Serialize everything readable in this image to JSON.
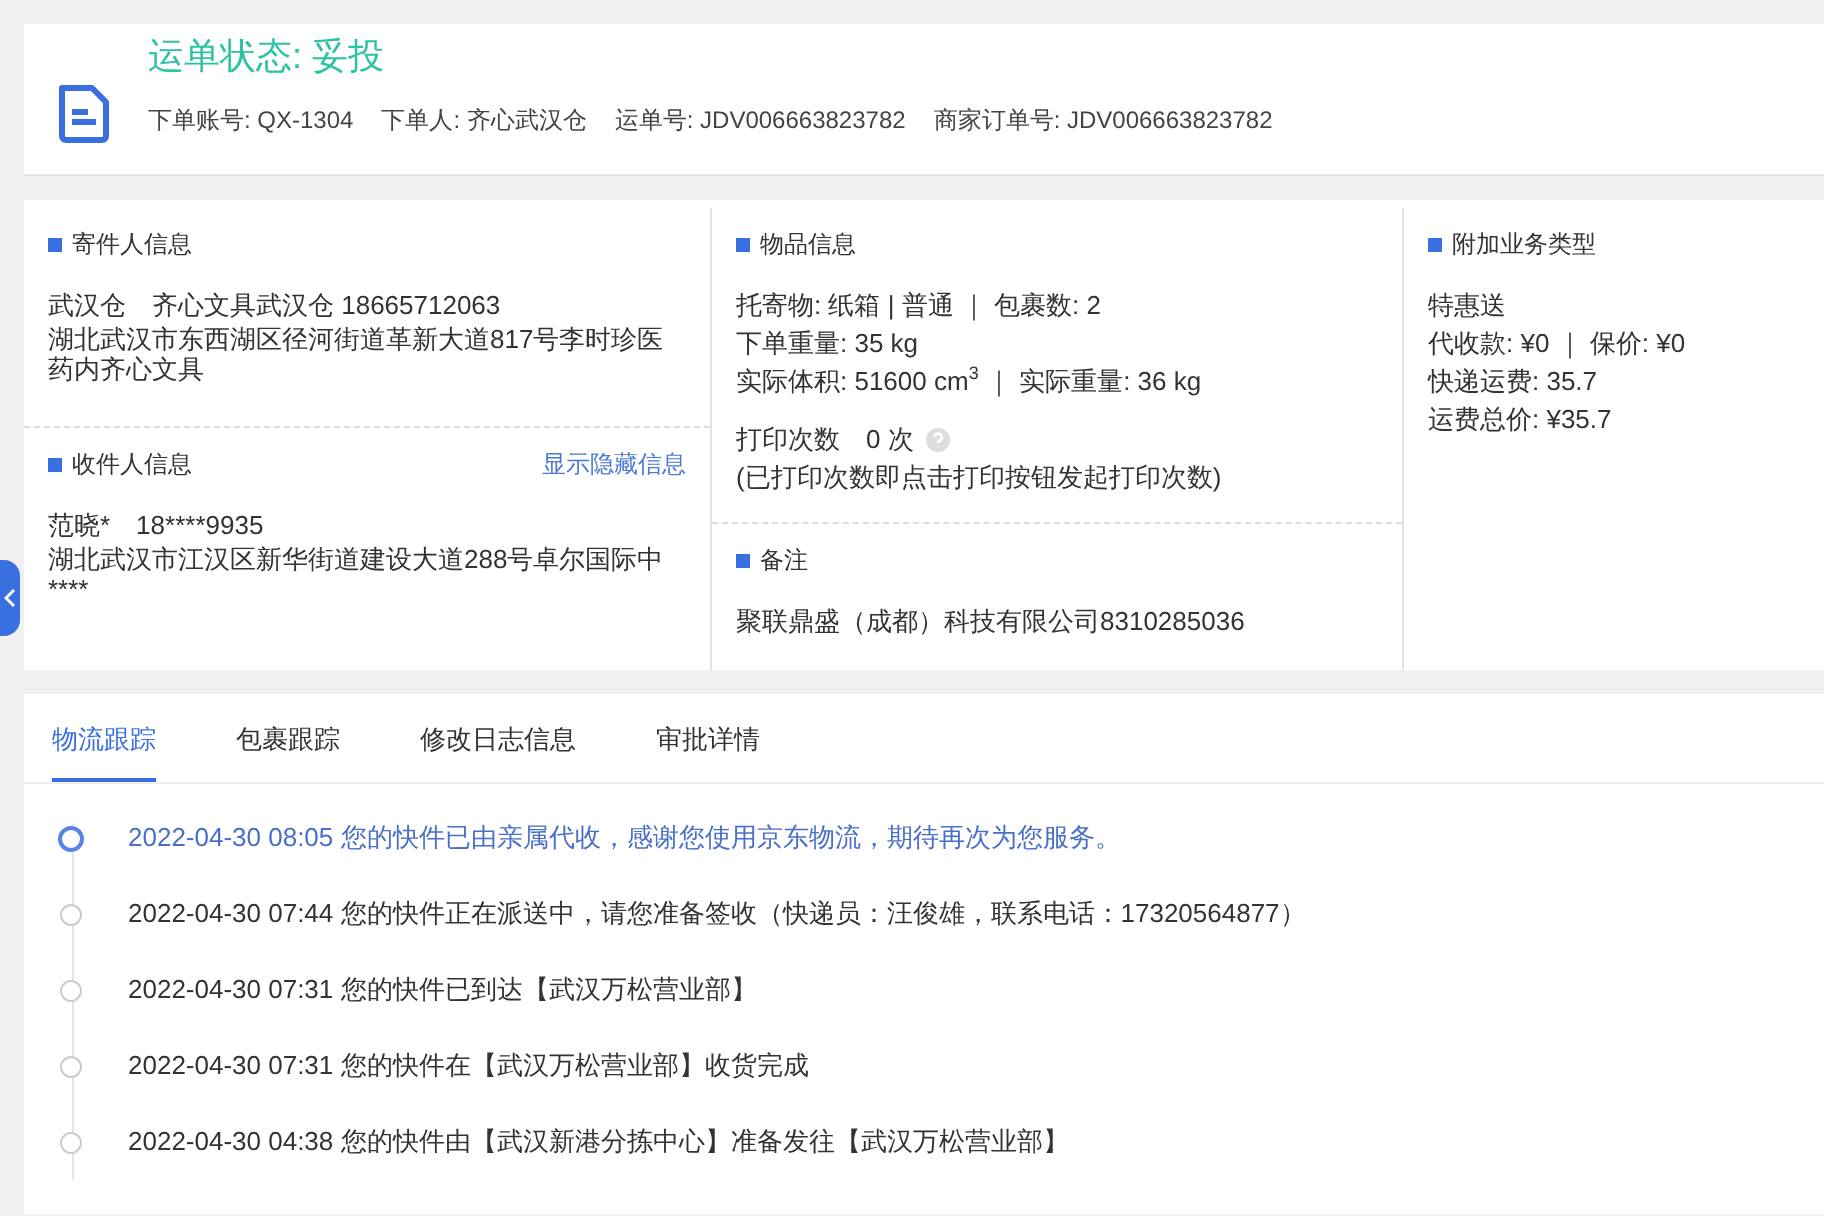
{
  "header": {
    "status": "运单状态: 妥投",
    "meta": [
      "下单账号: QX-1304",
      "下单人: 齐心武汉仓",
      "运单号: JDV006663823782",
      "商家订单号: JDV006663823782"
    ]
  },
  "sender": {
    "title": "寄件人信息",
    "contact": "武汉仓　齐心文具武汉仓 18665712063",
    "address": "湖北武汉市东西湖区径河街道革新大道817号李时珍医药内齐心文具"
  },
  "receiver": {
    "title": "收件人信息",
    "link": "显示隐藏信息",
    "contact": "范晓*　18****9935",
    "address": "湖北武汉市江汉区新华街道建设大道288号卓尔国际中****"
  },
  "goods": {
    "title": "物品信息",
    "lines": [
      "托寄物:  纸箱 | 普通 ｜ 包裹数:  2",
      "下单重量:  35 kg",
      "实际体积:   51600 cm$^{3}$ ｜ 实际重量:  36 kg"
    ],
    "print_count": "打印次数　0 次",
    "print_note": "(已打印次数即点击打印按钮发起打印次数)"
  },
  "remark": {
    "title": "备注",
    "text": "聚联鼎盛（成都）科技有限公司8310285036"
  },
  "extra": {
    "title": "附加业务类型",
    "lines": [
      "特惠送",
      "代收款:  ¥0 ｜ 保价:  ¥0",
      "快递运费:  35.7",
      "运费总价:  ¥35.7"
    ]
  },
  "tabs": [
    {
      "label": "物流跟踪",
      "selected": true
    },
    {
      "label": "包裹跟踪",
      "selected": false
    },
    {
      "label": "修改日志信息",
      "selected": false
    },
    {
      "label": "审批详情",
      "selected": false
    }
  ],
  "events": [
    {
      "text": "2022-04-30 08:05 您的快件已由亲属代收，感谢您使用京东物流，期待再次为您服务。",
      "active": true
    },
    {
      "text": "2022-04-30 07:44 您的快件正在派送中，请您准备签收（快递员：汪俊雄，联系电话：17320564877）",
      "active": false
    },
    {
      "text": "2022-04-30 07:31 您的快件已到达【武汉万松营业部】",
      "active": false
    },
    {
      "text": "2022-04-30 07:31 您的快件在【武汉万松营业部】收货完成",
      "active": false
    },
    {
      "text": "2022-04-30 04:38 您的快件由【武汉新港分拣中心】准备发往【武汉万松营业部】",
      "active": false
    }
  ]
}
